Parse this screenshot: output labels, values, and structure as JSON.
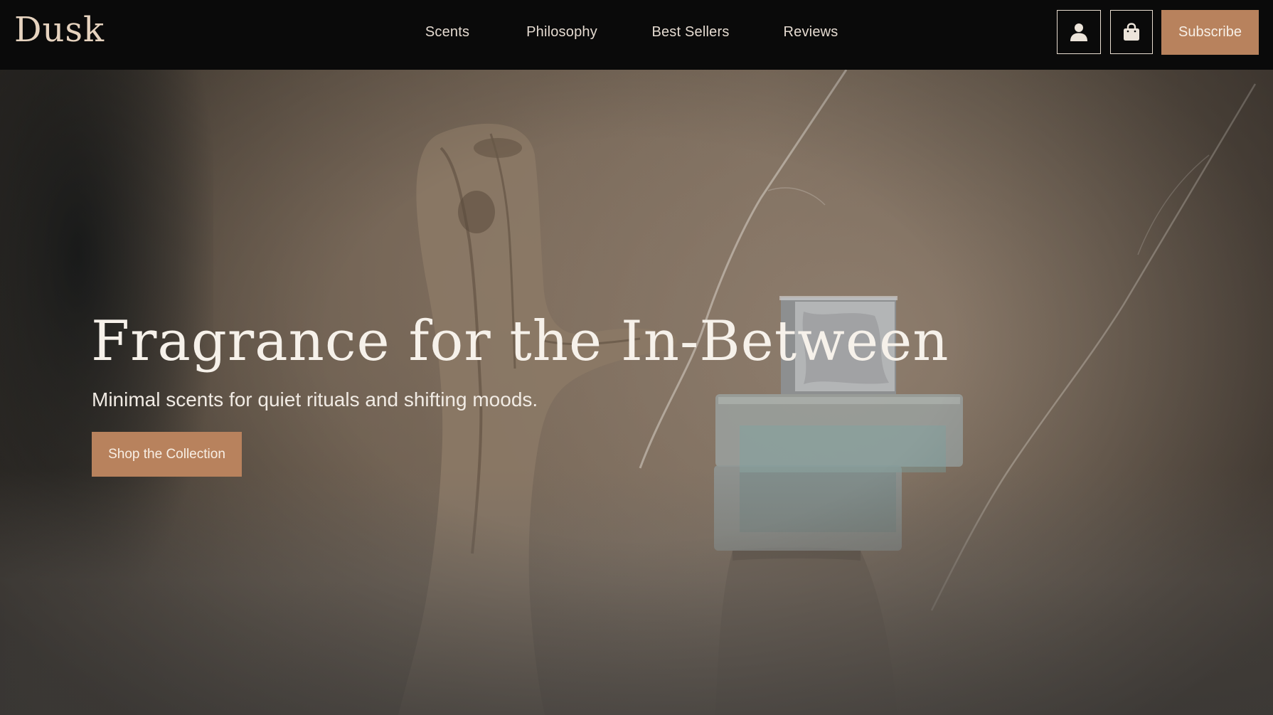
{
  "brand": {
    "logo_text": "Dusk"
  },
  "nav": {
    "links": [
      {
        "label": "Scents"
      },
      {
        "label": "Philosophy"
      },
      {
        "label": "Best Sellers"
      },
      {
        "label": "Reviews"
      }
    ]
  },
  "header_actions": {
    "account_icon": "user-icon",
    "cart_icon": "shopping-bag-icon",
    "subscribe_label": "Subscribe"
  },
  "hero": {
    "title": "Fragrance for the In-Between",
    "subtitle": "Minimal scents for quiet rituals and shifting moods.",
    "cta_label": "Shop the Collection"
  },
  "colors": {
    "accent": "#b8825d",
    "header_bg": "#0a0a0a",
    "logo": "#e6d3bf"
  }
}
